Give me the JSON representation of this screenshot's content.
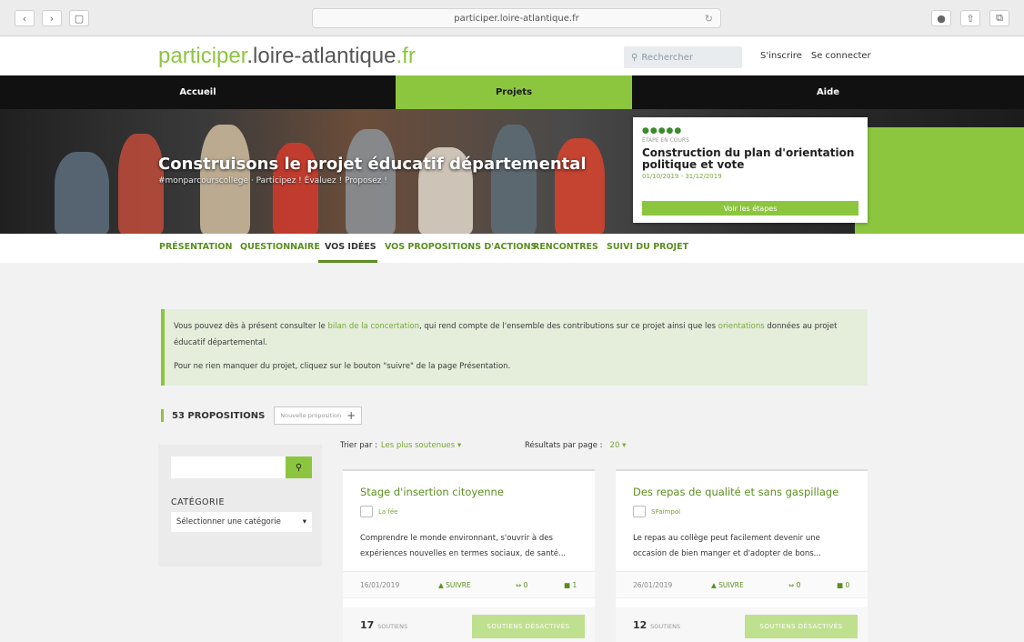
{
  "browser": {
    "url": "participer.loire-atlantique.fr",
    "back": "‹",
    "forward": "›",
    "sidebar_icon": "▢",
    "reload_icon": "↻",
    "info_icon": "●",
    "share_icon": "⇧",
    "tabs_icon": "⧉"
  },
  "header": {
    "logo_green1": "participer",
    "logo_mid": ".loire-atlantique",
    "logo_green2": ".fr",
    "search_placeholder": "Rechercher",
    "signup": "S'inscrire",
    "login": "Se connecter"
  },
  "mainnav": [
    {
      "label": "Accueil",
      "active": false
    },
    {
      "label": "Projets",
      "active": true
    },
    {
      "label": "Aide",
      "active": false
    }
  ],
  "hero": {
    "title": "Construisons le projet éducatif départemental",
    "subtitle": "#monparcourscollege · Participez ! Évaluez ! Proposez !"
  },
  "step_card": {
    "dots": "●●●●●",
    "label": "ÉTAPE EN COURS",
    "title": "Construction du plan d'orientation politique et vote",
    "dates": "01/10/2019 - 31/12/2019",
    "button": "Voir les étapes"
  },
  "subnav": [
    {
      "label": "PRÉSENTATION",
      "active": false
    },
    {
      "label": "QUESTIONNAIRE",
      "active": false
    },
    {
      "label": "VOS IDÉES",
      "active": true
    },
    {
      "label": "VOS PROPOSITIONS D'ACTIONS",
      "active": false
    },
    {
      "label": "RENCONTRES",
      "active": false
    },
    {
      "label": "SUIVI DU PROJET",
      "active": false
    }
  ],
  "notice": {
    "p1_a": "Vous pouvez dès à présent consulter le ",
    "p1_link1": "bilan de la concertation",
    "p1_b": ", qui rend compte de l'ensemble des contributions sur ce projet ainsi que les ",
    "p1_link2": "orientations",
    "p1_c": " données au projet éducatif départemental.",
    "p2": "Pour ne rien manquer du projet, cliquez sur le bouton \"suivre\" de la page Présentation."
  },
  "propositions": {
    "count": "53 PROPOSITIONS",
    "new_button": "Nouvelle proposition",
    "new_plus": "+"
  },
  "sidebar": {
    "search_icon": "⚲",
    "category_label": "CATÉGORIE",
    "category_select": "Sélectionner une catégorie",
    "select_arrow": "▾"
  },
  "sort": {
    "label": "Trier par :",
    "value": "Les plus soutenues",
    "arrow": "▾",
    "per_page_label": "Résultats par page :",
    "per_page_value": "20"
  },
  "cards": [
    {
      "title": "Stage d'insertion citoyenne",
      "author": "La fée",
      "description": "Comprendre le monde environnant, s'ouvrir à des expériences nouvelles en termes sociaux, de santé...",
      "date": "16/01/2019",
      "follow": "▲ SUIVRE",
      "votes": "⇔ 0",
      "comments": "■ 1",
      "supports_num": "17",
      "supports_word": "SOUTIENS",
      "button": "SOUTIENS DÉSACTIVÉS"
    },
    {
      "title": "Des repas de qualité et sans gaspillage",
      "author": "SPaimpol",
      "description": "Le repas au collège peut facilement devenir une occasion de bien manger et d'adopter de bons...",
      "date": "26/01/2019",
      "follow": "▲ SUIVRE",
      "votes": "⇔ 0",
      "comments": "■ 0",
      "supports_num": "12",
      "supports_word": "SOUTIENS",
      "button": "SOUTIENS DÉSACTIVÉS"
    }
  ],
  "colors": {
    "brand_green": "#8cc63f",
    "dark_green": "#5b8e1f",
    "nav_black": "#111111"
  }
}
